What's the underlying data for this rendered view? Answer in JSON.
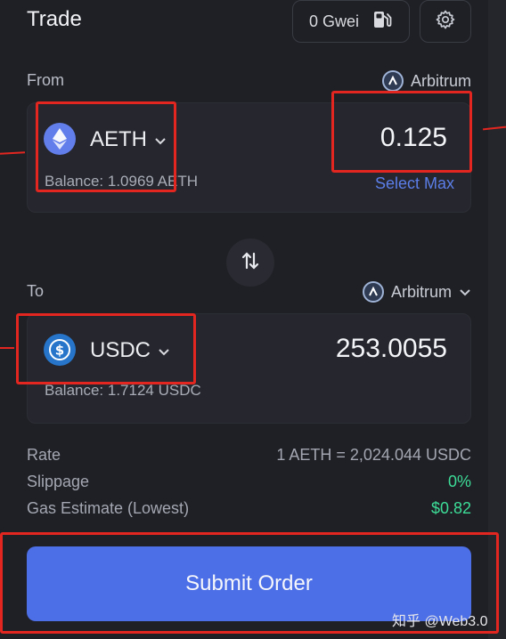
{
  "header": {
    "title": "Trade",
    "gas_label": "0 Gwei",
    "gas_icon": "fuel-pump-icon",
    "settings_icon": "gear-icon"
  },
  "from": {
    "label": "From",
    "network": "Arbitrum",
    "token": "AETH",
    "token_icon": "ethereum-icon",
    "balance": "Balance: 1.0969 AETH",
    "amount": "0.125",
    "select_max": "Select Max"
  },
  "swap_icon": "swap-arrows-icon",
  "to": {
    "label": "To",
    "network": "Arbitrum",
    "token": "USDC",
    "token_icon": "usdc-icon",
    "balance": "Balance: 1.7124 USDC",
    "amount": "253.0055"
  },
  "info": {
    "rate_label": "Rate",
    "rate_value": "1 AETH = 2,024.044 USDC",
    "slippage_label": "Slippage",
    "slippage_value": "0%",
    "gas_label": "Gas Estimate (Lowest)",
    "gas_value": "$0.82"
  },
  "submit_label": "Submit Order",
  "watermark": "知乎 @Web3.0",
  "colors": {
    "accent": "#4c6ee6",
    "positive": "#3ddc97",
    "annotation": "#e3261f",
    "link": "#5b7ee8"
  }
}
